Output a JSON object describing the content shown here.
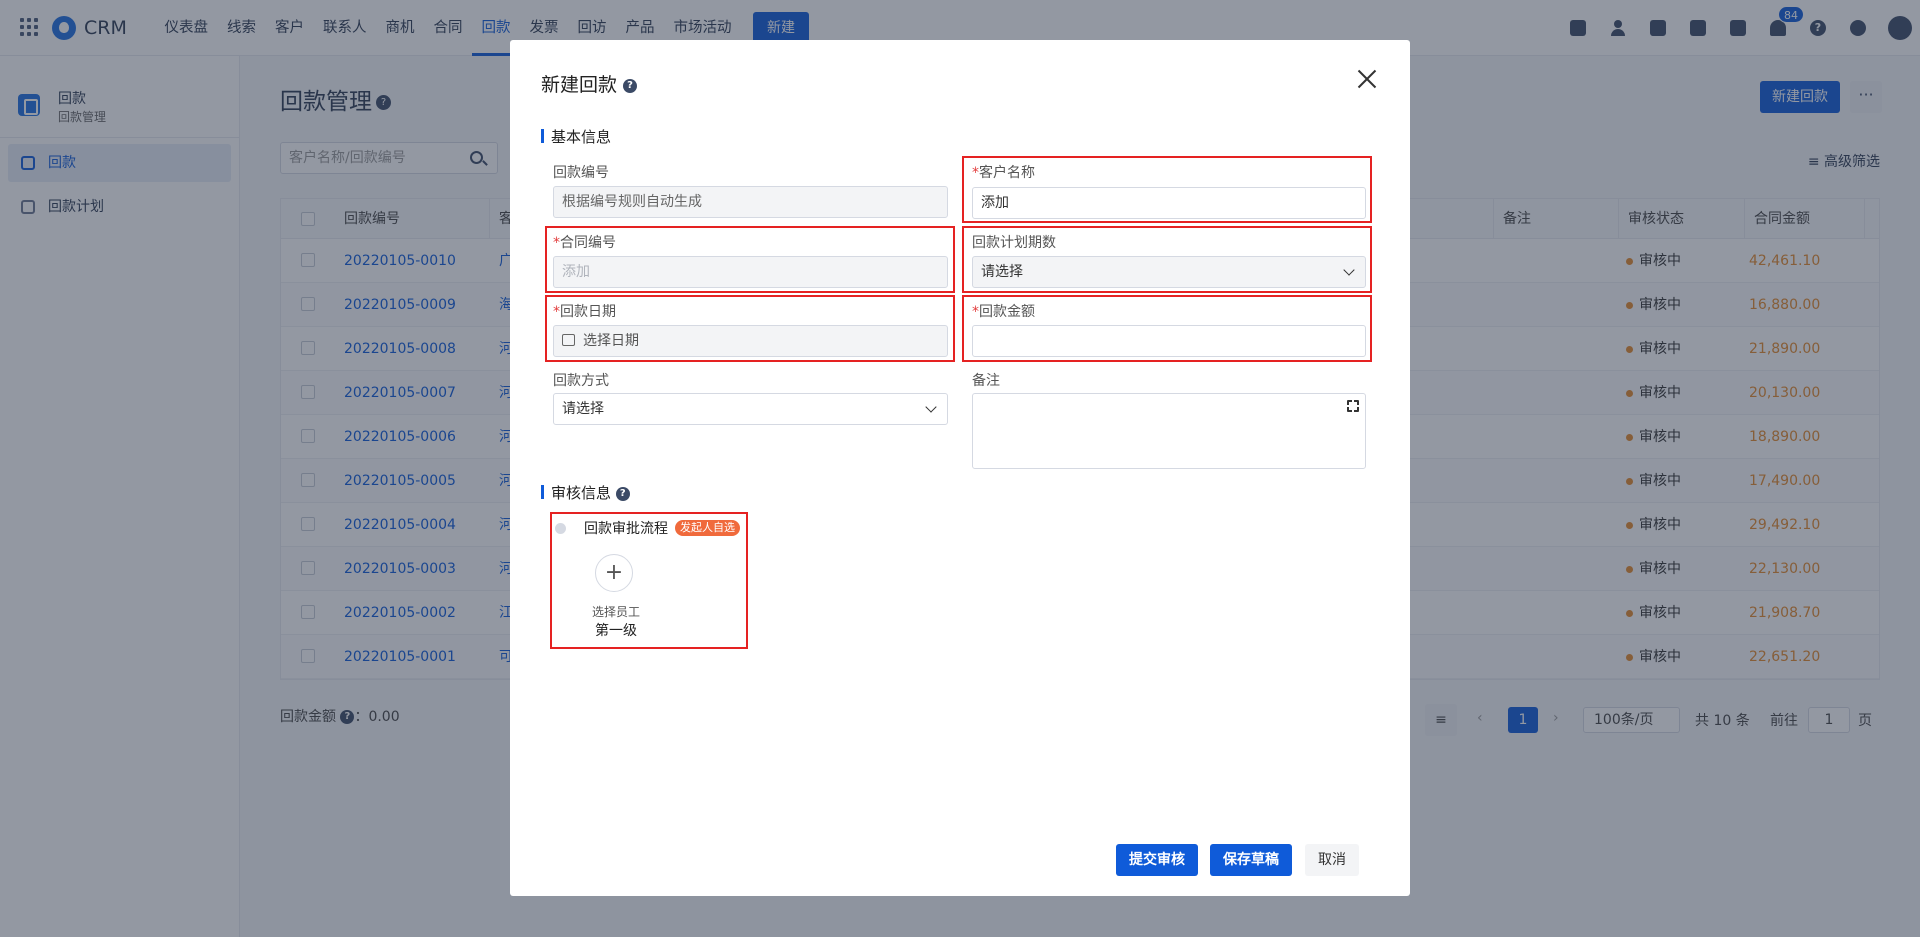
{
  "app": {
    "name": "CRM"
  },
  "nav": {
    "items": [
      "仪表盘",
      "线索",
      "客户",
      "联系人",
      "商机",
      "合同",
      "回款",
      "发票",
      "回访",
      "产品",
      "市场活动"
    ],
    "new_label": "新建",
    "notifications": "84"
  },
  "sidebar": {
    "module": "回款",
    "module_sub": "回款管理",
    "items": [
      {
        "label": "回款"
      },
      {
        "label": "回款计划"
      }
    ]
  },
  "page": {
    "title": "回款管理",
    "new_button": "新建回款",
    "more": "···",
    "search_placeholder": "客户名称/回款编号",
    "advanced_filter": "高级筛选"
  },
  "table": {
    "columns": [
      "回款编号",
      "客户名称",
      "备注",
      "审核状态",
      "合同金额"
    ],
    "rows": [
      {
        "code": "20220105-0010",
        "cust": "广",
        "status": "审核中",
        "amount": "42,461.10"
      },
      {
        "code": "20220105-0009",
        "cust": "海",
        "status": "审核中",
        "amount": "16,880.00"
      },
      {
        "code": "20220105-0008",
        "cust": "河",
        "status": "审核中",
        "amount": "21,890.00"
      },
      {
        "code": "20220105-0007",
        "cust": "河",
        "status": "审核中",
        "amount": "20,130.00"
      },
      {
        "code": "20220105-0006",
        "cust": "河",
        "status": "审核中",
        "amount": "18,890.00"
      },
      {
        "code": "20220105-0005",
        "cust": "河",
        "status": "审核中",
        "amount": "17,490.00"
      },
      {
        "code": "20220105-0004",
        "cust": "河",
        "status": "审核中",
        "amount": "29,492.10"
      },
      {
        "code": "20220105-0003",
        "cust": "河",
        "status": "审核中",
        "amount": "22,130.00"
      },
      {
        "code": "20220105-0002",
        "cust": "江",
        "status": "审核中",
        "amount": "21,908.70"
      },
      {
        "code": "20220105-0001",
        "cust": "可",
        "status": "审核中",
        "amount": "22,651.20"
      }
    ],
    "sum_label": "回款金额",
    "sum_value": "：0.00"
  },
  "pager": {
    "current": "1",
    "page_size": "100条/页",
    "total": "共 10 条",
    "goto_label": "前往",
    "goto_value": "1",
    "page_unit": "页"
  },
  "modal": {
    "title": "新建回款",
    "section_basic": "基本信息",
    "fields": {
      "receipt_no": {
        "label": "回款编号",
        "value": "根据编号规则自动生成"
      },
      "customer": {
        "label": "客户名称",
        "placeholder": "添加"
      },
      "contract": {
        "label": "合同编号",
        "placeholder": "添加"
      },
      "plan_period": {
        "label": "回款计划期数",
        "value": "请选择"
      },
      "date": {
        "label": "回款日期",
        "placeholder": "选择日期"
      },
      "amount": {
        "label": "回款金额",
        "value": ""
      },
      "method": {
        "label": "回款方式",
        "value": "请选择"
      },
      "remark": {
        "label": "备注"
      }
    },
    "section_review": "审核信息",
    "flow": {
      "name": "回款审批流程",
      "tag": "发起人自选",
      "pick": "选择员工",
      "level": "第一级"
    },
    "buttons": {
      "submit": "提交审核",
      "draft": "保存草稿",
      "cancel": "取消"
    }
  },
  "colors": {
    "accent": "#0f5bd9",
    "highlight": "#e52222",
    "status_dot": "#e58a2c",
    "amount": "#e58a2c"
  }
}
